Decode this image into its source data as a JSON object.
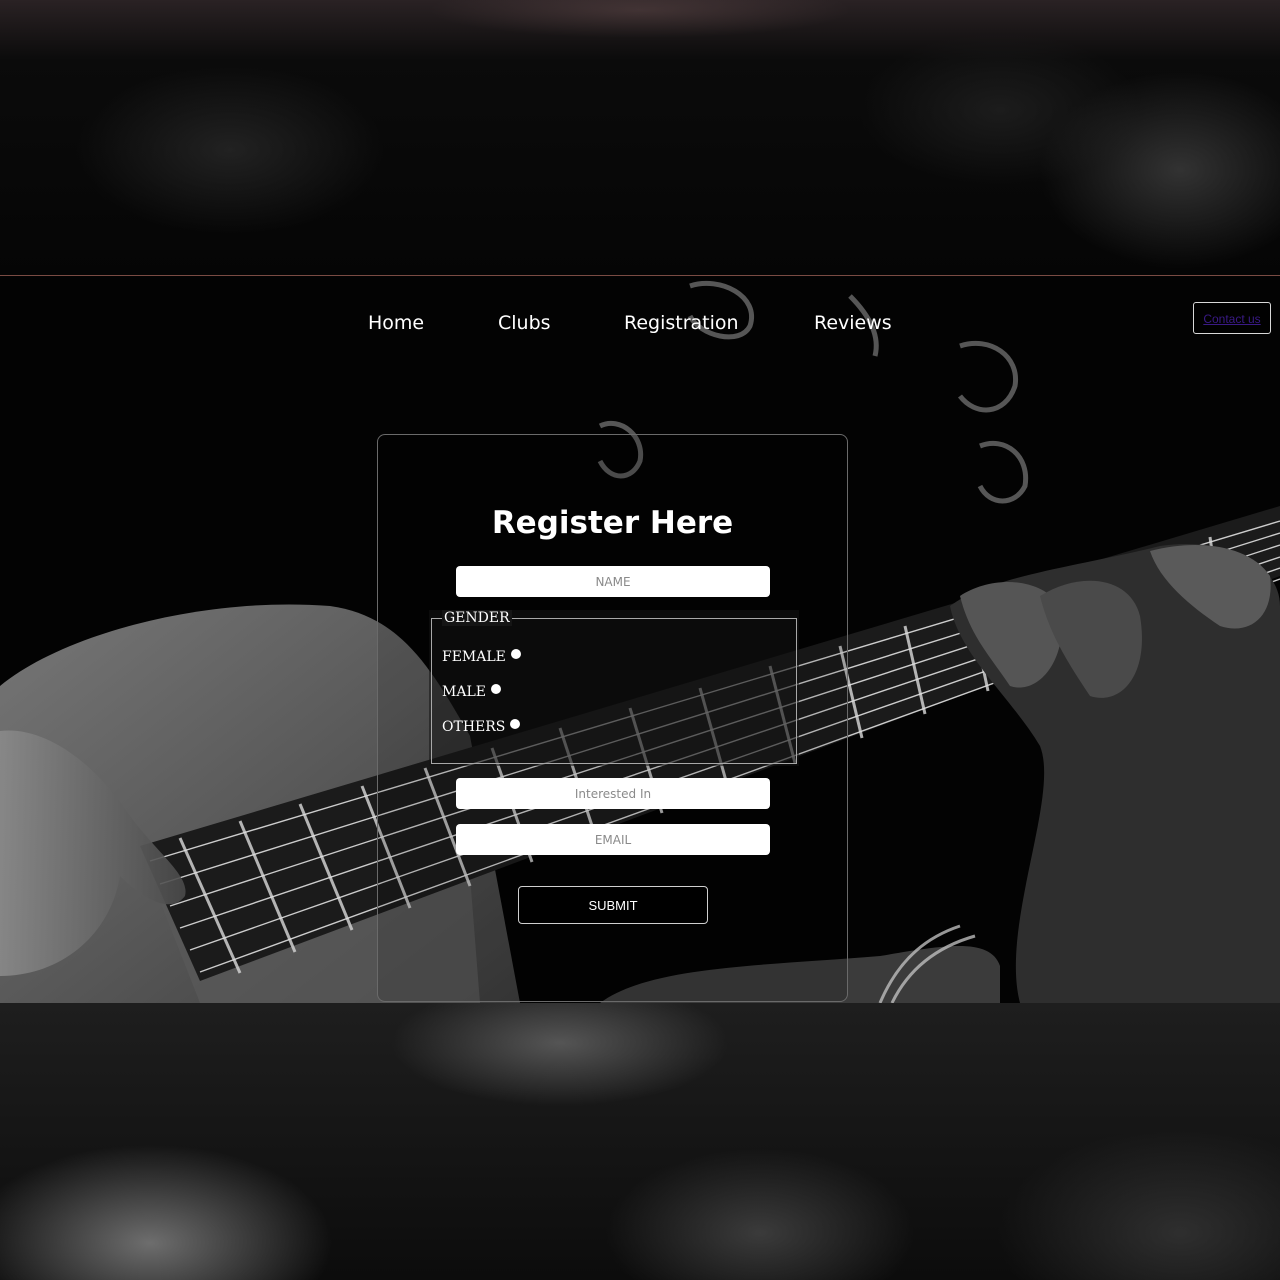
{
  "nav": {
    "items": [
      {
        "label": "Home"
      },
      {
        "label": "Clubs"
      },
      {
        "label": "Registration"
      },
      {
        "label": "Reviews"
      }
    ],
    "contact_label": "Contact us"
  },
  "form": {
    "title": "Register Here",
    "name_placeholder": "NAME",
    "gender_legend": "GENDER",
    "gender_options": [
      {
        "label": "FEMALE"
      },
      {
        "label": "MALE"
      },
      {
        "label": "OTHERS"
      }
    ],
    "interest_placeholder": "Interested In",
    "email_placeholder": "EMAIL",
    "submit_label": "SUBMIT"
  },
  "colors": {
    "page_bg": "#000000",
    "text": "#ffffff",
    "link": "#3a1a86",
    "card_border": "#6a6a6a"
  }
}
